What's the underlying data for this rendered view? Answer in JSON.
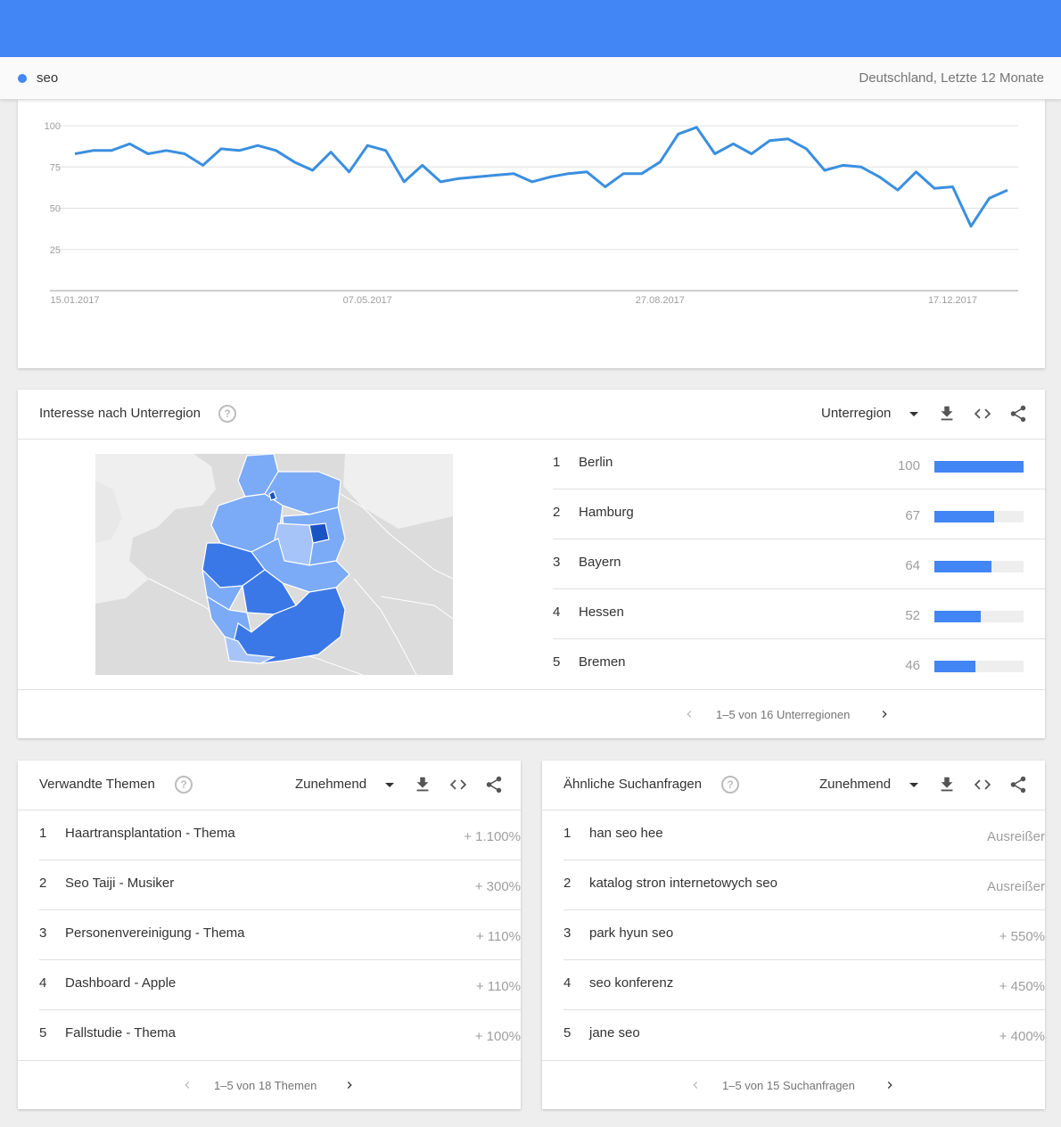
{
  "term": {
    "name": "seo",
    "color": "#4285f4",
    "meta": "Deutschland, Letzte 12 Monate"
  },
  "chart_data": {
    "type": "line",
    "y_ticks": [
      "100",
      "75",
      "50",
      "25"
    ],
    "ylim": [
      0,
      100
    ],
    "x_tick_labels": [
      "15.01.2017",
      "07.05.2017",
      "27.08.2017",
      "17.12.2017"
    ],
    "series": [
      {
        "color": "#3a8fe0",
        "values": [
          83,
          85,
          85,
          89,
          83,
          85,
          83,
          76,
          86,
          85,
          88,
          85,
          78,
          73,
          84,
          72,
          88,
          85,
          66,
          76,
          66,
          68,
          69,
          70,
          71,
          66,
          69,
          71,
          72,
          63,
          71,
          71,
          78,
          95,
          99,
          83,
          89,
          83,
          91,
          92,
          86,
          73,
          76,
          75,
          69,
          61,
          72,
          62,
          63,
          39,
          56,
          61
        ]
      }
    ]
  },
  "region": {
    "title": "Interesse nach Unterregion",
    "help": "?",
    "dropdown": "Unterregion",
    "rows": [
      {
        "rank": "1",
        "name": "Berlin",
        "value": "100",
        "fill": 100
      },
      {
        "rank": "2",
        "name": "Hamburg",
        "value": "67",
        "fill": 67
      },
      {
        "rank": "3",
        "name": "Bayern",
        "value": "64",
        "fill": 64
      },
      {
        "rank": "4",
        "name": "Hessen",
        "value": "52",
        "fill": 52
      },
      {
        "rank": "5",
        "name": "Bremen",
        "value": "46",
        "fill": 46
      }
    ],
    "pager": "1–5 von 16 Unterregionen"
  },
  "topics": {
    "title": "Verwandte Themen",
    "help": "?",
    "dropdown": "Zunehmend",
    "rows": [
      {
        "rank": "1",
        "name": "Haartransplantation - Thema",
        "value": "+ 1.100%"
      },
      {
        "rank": "2",
        "name": "Seo Taiji - Musiker",
        "value": "+ 300%"
      },
      {
        "rank": "3",
        "name": "Personenvereinigung - Thema",
        "value": "+ 110%"
      },
      {
        "rank": "4",
        "name": "Dashboard - Apple",
        "value": "+ 110%"
      },
      {
        "rank": "5",
        "name": "Fallstudie - Thema",
        "value": "+ 100%"
      }
    ],
    "pager": "1–5 von 18 Themen"
  },
  "queries": {
    "title": "Ähnliche Suchanfragen",
    "help": "?",
    "dropdown": "Zunehmend",
    "rows": [
      {
        "rank": "1",
        "name": "han seo hee",
        "value": "Ausreißer"
      },
      {
        "rank": "2",
        "name": "katalog stron internetowych seo",
        "value": "Ausreißer"
      },
      {
        "rank": "3",
        "name": "park hyun seo",
        "value": "+ 550%"
      },
      {
        "rank": "4",
        "name": "seo konferenz",
        "value": "+ 450%"
      },
      {
        "rank": "5",
        "name": "jane seo",
        "value": "+ 400%"
      }
    ],
    "pager": "1–5 von 15 Suchanfragen"
  },
  "icons": {
    "download": "download-icon",
    "embed": "embed-icon",
    "share": "share-icon"
  },
  "colors": {
    "accent": "#4285f4",
    "map_dark": "#3b78e7",
    "map_light": "#7baaf7",
    "map_berlin": "#1a53c4"
  }
}
